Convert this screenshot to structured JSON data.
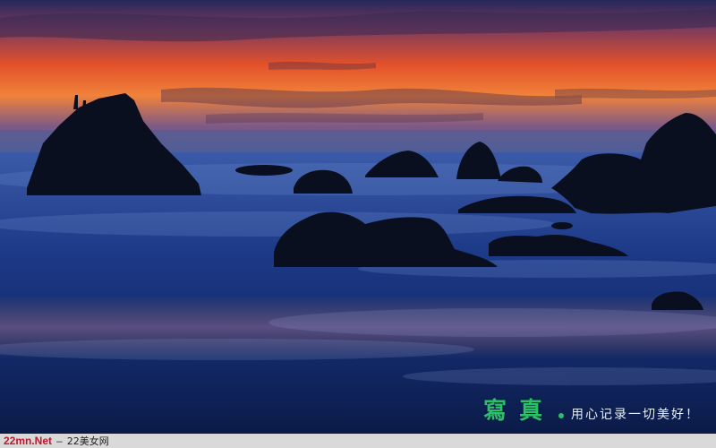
{
  "photo": {
    "sky_colors": [
      "#1f2a5a",
      "#6a3a6a",
      "#e0522a",
      "#f08a3a",
      "#5c6aa0"
    ],
    "sea_colors": [
      "#2a4a9a",
      "#163070",
      "#0c1d4a"
    ],
    "rock_color": "#0a0f1f"
  },
  "watermark": {
    "seal_text": "寫真",
    "slogan": "用心记录一切美好！",
    "color": "#2bbf6a"
  },
  "footer": {
    "site": "22mn.Net",
    "separator": "–",
    "name": "22美女网"
  }
}
